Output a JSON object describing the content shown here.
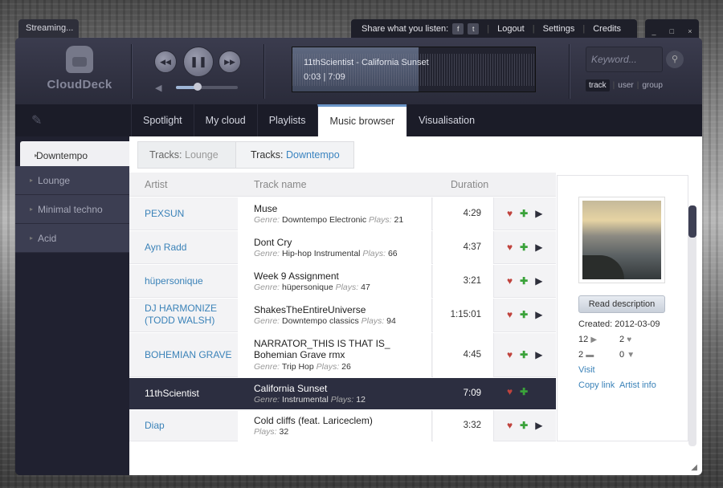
{
  "topbar": {
    "streaming_tab": "Streaming...",
    "share_label": "Share what you listen:",
    "facebook_glyph": "f",
    "twitter_glyph": "t",
    "logout": "Logout",
    "settings": "Settings",
    "credits": "Credits",
    "minimize_glyph": "_",
    "maximize_glyph": "□",
    "close_glyph": "×"
  },
  "logo": {
    "name": "CloudDeck"
  },
  "player": {
    "prev_glyph": "◀◀",
    "pause_glyph": "❚❚",
    "next_glyph": "▶▶",
    "volume_glyph": "◀",
    "volume_level": 0.35,
    "track_title": "11thScientist - California Sunset",
    "time": "0:03 | 7:09",
    "progress": 0.52
  },
  "search": {
    "placeholder": "Keyword...",
    "button_glyph": "⚲",
    "types": [
      "track",
      "user",
      "group"
    ],
    "active_type": "track"
  },
  "nav": {
    "edit_icon": "✎",
    "tabs": [
      "Spotlight",
      "My cloud",
      "Playlists",
      "Music browser",
      "Visualisation"
    ],
    "active": "Music browser"
  },
  "sidebar": {
    "genres": [
      "Downtempo",
      "Lounge",
      "Minimal techno",
      "Acid"
    ],
    "active": "Downtempo"
  },
  "breadcrumb": {
    "c1": {
      "label": "Tracks:",
      "value": "Lounge"
    },
    "c2": {
      "label": "Tracks:",
      "value": "Downtempo"
    }
  },
  "table": {
    "headers": {
      "artist": "Artist",
      "track": "Track name",
      "duration": "Duration"
    },
    "genre_label": "Genre:",
    "plays_label": "Plays:",
    "rows": [
      {
        "artist": "PEXSUN",
        "track": "Muse",
        "genre": "Downtempo Electronic",
        "plays": "21",
        "duration": "4:29"
      },
      {
        "artist": "Ayn Radd",
        "track": "Dont Cry",
        "genre": "Hip-hop Instrumental",
        "plays": "66",
        "duration": "4:37"
      },
      {
        "artist": "hüpersonique",
        "track": "Week 9 Assignment",
        "genre": "hüpersonique",
        "plays": "47",
        "duration": "3:21"
      },
      {
        "artist": "DJ HARMONIZE (TODD WALSH)",
        "track": "ShakesTheEntireUniverse",
        "genre": "Downtempo classics",
        "plays": "94",
        "duration": "1:15:01"
      },
      {
        "artist": "BOHEMIAN GRAVE",
        "track": "NARRATOR_THIS IS THAT IS_ Bohemian Grave rmx",
        "genre": "Trip Hop",
        "plays": "26",
        "duration": "4:45"
      },
      {
        "artist": "11thScientist",
        "track": "California Sunset",
        "genre": "Instrumental",
        "plays": "12",
        "duration": "7:09"
      },
      {
        "artist": "Diap",
        "track": "Cold cliffs (feat. Lariceclem)",
        "genre": "",
        "plays": "32",
        "duration": "3:32"
      }
    ],
    "action_glyphs": {
      "like": "♥",
      "add": "✚",
      "play": "▶"
    }
  },
  "detail": {
    "read_description": "Read description",
    "created": "Created: 2012-03-09",
    "stats": {
      "plays": "12",
      "likes": "2",
      "comments": "2",
      "downloads": "0"
    },
    "stat_glyphs": {
      "plays": "▶",
      "likes": "♥",
      "comments": "▬",
      "downloads": "▼"
    },
    "visit": "Visit",
    "copy_link": "Copy link",
    "artist_info": "Artist info"
  },
  "resize_glyph": "◢"
}
